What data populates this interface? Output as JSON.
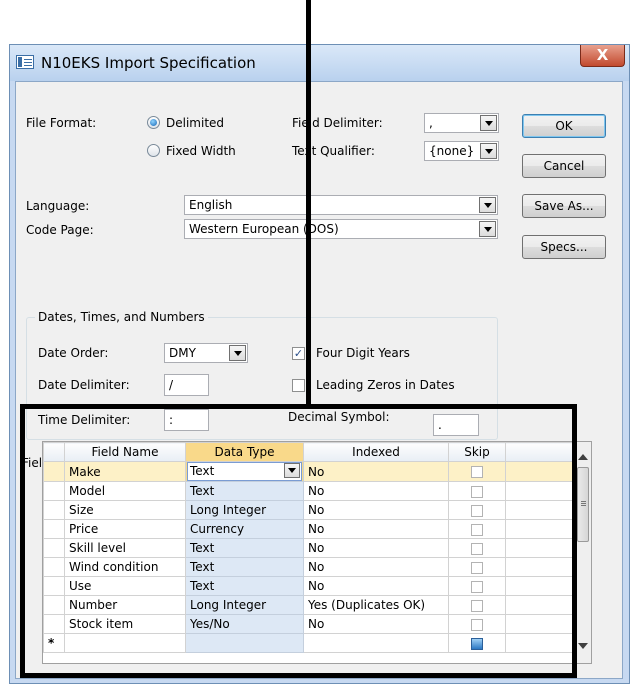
{
  "window": {
    "title": "N10EKS Import Specification",
    "close_label": "X"
  },
  "file_format": {
    "label": "File Format:",
    "options": [
      "Delimited",
      "Fixed Width"
    ],
    "selected": "Delimited"
  },
  "field_delimiter": {
    "label": "Field Delimiter:",
    "value": ","
  },
  "text_qualifier": {
    "label": "Text Qualifier:",
    "value": "{none}"
  },
  "language": {
    "label": "Language:",
    "value": "English"
  },
  "code_page": {
    "label": "Code Page:",
    "value": "Western European (DOS)"
  },
  "buttons": {
    "ok": "OK",
    "cancel": "Cancel",
    "save_as": "Save As...",
    "specs": "Specs..."
  },
  "dates": {
    "group_title": "Dates, Times, and Numbers",
    "date_order_label": "Date Order:",
    "date_order_value": "DMY",
    "date_delimiter_label": "Date Delimiter:",
    "date_delimiter_value": "/",
    "time_delimiter_label": "Time Delimiter:",
    "time_delimiter_value": ":",
    "four_digit_years_label": "Four Digit Years",
    "four_digit_years_checked": true,
    "leading_zeros_label": "Leading Zeros in Dates",
    "leading_zeros_checked": false,
    "decimal_symbol_label": "Decimal Symbol:",
    "decimal_symbol_value": "."
  },
  "field_info": {
    "label": "Field Information:",
    "columns": [
      "Field Name",
      "Data Type",
      "Indexed",
      "Skip"
    ],
    "rows": [
      {
        "field": "Make",
        "type": "Text",
        "indexed": "No"
      },
      {
        "field": "Model",
        "type": "Text",
        "indexed": "No"
      },
      {
        "field": "Size",
        "type": "Long Integer",
        "indexed": "No"
      },
      {
        "field": "Price",
        "type": "Currency",
        "indexed": "No"
      },
      {
        "field": "Skill level",
        "type": "Text",
        "indexed": "No"
      },
      {
        "field": "Wind condition",
        "type": "Text",
        "indexed": "No"
      },
      {
        "field": "Use",
        "type": "Text",
        "indexed": "No"
      },
      {
        "field": "Number",
        "type": "Long Integer",
        "indexed": "Yes (Duplicates OK)"
      },
      {
        "field": "Stock item",
        "type": "Yes/No",
        "indexed": "No"
      }
    ],
    "new_row_marker": "*"
  },
  "colors": {
    "title_bar": "#c7d9f1",
    "dialog_bg": "#f0f0f0",
    "active_header": "#f9d98a",
    "selected_column": "#dde8f5",
    "close_button": "#c24a2e",
    "annotation": "#000000"
  }
}
